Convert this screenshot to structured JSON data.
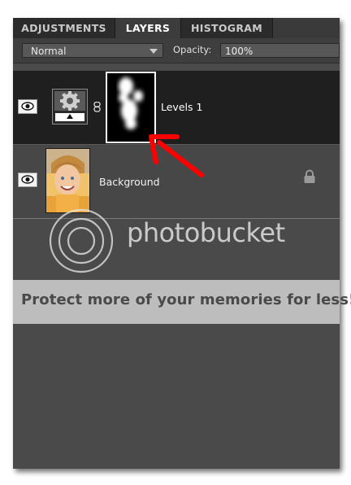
{
  "tabs": {
    "adjustments": "ADJUSTMENTS",
    "layers": "LAYERS",
    "histogram": "HISTOGRAM",
    "active": "LAYERS"
  },
  "options": {
    "blend_mode": "Normal",
    "opacity_label": "Opacity:",
    "opacity_value": "100%"
  },
  "layers": [
    {
      "name": "Levels 1",
      "type": "adjustment",
      "visible": true,
      "selected": true,
      "has_mask": true
    },
    {
      "name": "Background",
      "type": "image",
      "visible": true,
      "locked": true
    }
  ],
  "watermark": {
    "brand": "photobucket",
    "promo": "Protect more of your memories for less!"
  },
  "colors": {
    "panel_bg": "#4a4a4a",
    "selected_row": "#1f1f1f",
    "annotation_arrow": "#ff0000"
  }
}
